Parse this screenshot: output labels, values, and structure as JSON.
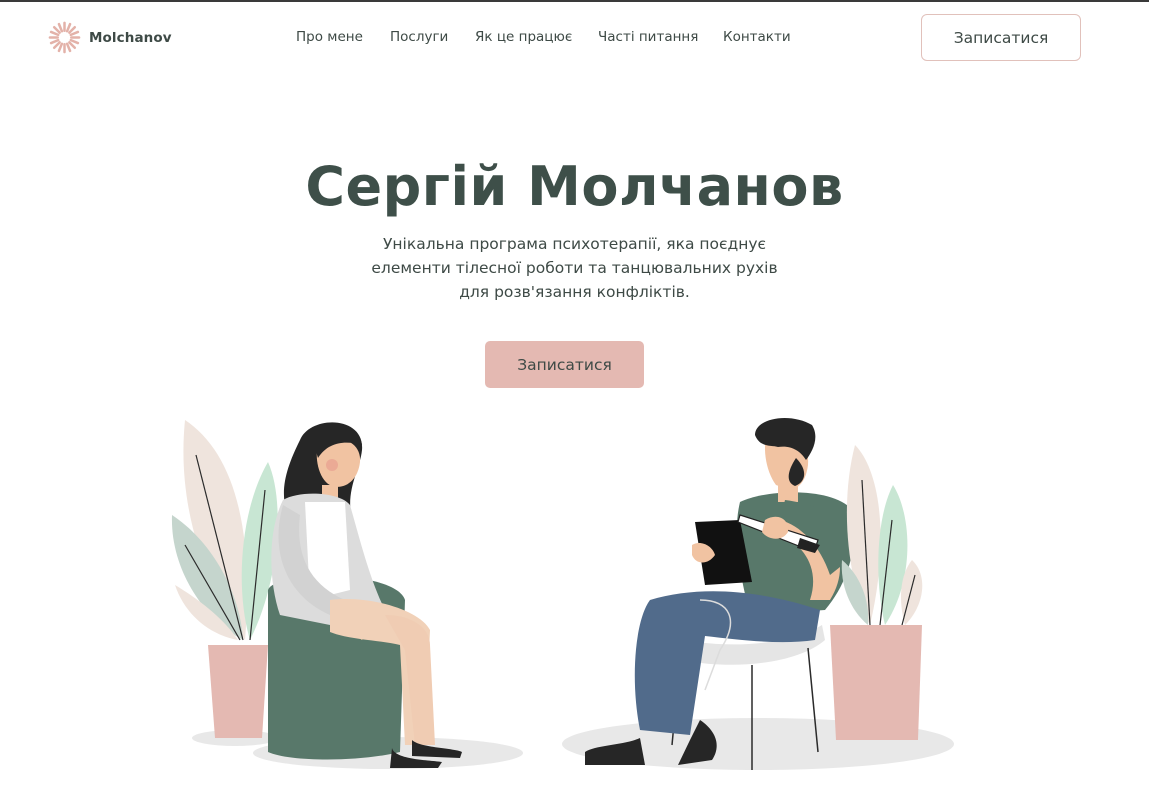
{
  "header": {
    "logo_text": "Molchanov",
    "logo_icon": "sunburst-logo-icon",
    "nav": [
      {
        "label": "Про мене"
      },
      {
        "label": "Послуги"
      },
      {
        "label": "Як це працює"
      },
      {
        "label": "Часті питання"
      },
      {
        "label": "Контакти"
      }
    ],
    "cta_label": "Записатися"
  },
  "hero": {
    "title": "Сергій Молчанов",
    "subtitle_lines": [
      "Унікальна програма психотерапії, яка поєднує",
      "елементи тілесної роботи та танцювальних рухів",
      "для розв'язання конфліктів."
    ],
    "cta_label": "Записатися"
  },
  "colors": {
    "accent": "#e4b9b2",
    "text": "#3e4f49",
    "border": "#e1c1bb"
  }
}
